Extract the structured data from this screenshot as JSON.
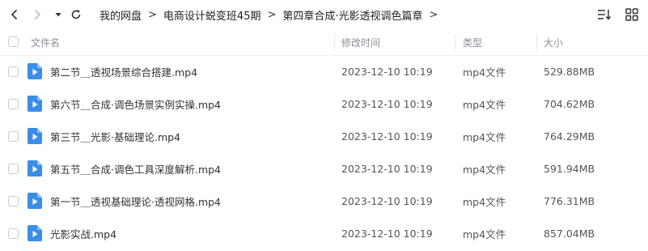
{
  "breadcrumb": [
    "我的网盘",
    "电商设计蜕变班45期",
    "第四章合成·光影透视调色篇章"
  ],
  "columns": {
    "name": "文件名",
    "modified": "修改时间",
    "type": "类型",
    "size": "大小"
  },
  "files": [
    {
      "name": "第二节＿透视场景综合搭建.mp4",
      "modified": "2023-12-10 10:19",
      "type": "mp4文件",
      "size": "529.88MB"
    },
    {
      "name": "第六节＿合成·调色场景实例实操.mp4",
      "modified": "2023-12-10 10:19",
      "type": "mp4文件",
      "size": "704.62MB"
    },
    {
      "name": "第三节＿光影·基础理论.mp4",
      "modified": "2023-12-10 10:19",
      "type": "mp4文件",
      "size": "764.29MB"
    },
    {
      "name": "第五节＿合成·调色工具深度解析.mp4",
      "modified": "2023-12-10 10:19",
      "type": "mp4文件",
      "size": "591.94MB"
    },
    {
      "name": "第一节＿透视基础理论·透视网格.mp4",
      "modified": "2023-12-10 10:19",
      "type": "mp4文件",
      "size": "776.31MB"
    },
    {
      "name": "光影实战.mp4",
      "modified": "2023-12-10 10:19",
      "type": "mp4文件",
      "size": "857.04MB"
    }
  ],
  "icons": {
    "file": "video-file-icon",
    "accent": "#3a8de8"
  }
}
